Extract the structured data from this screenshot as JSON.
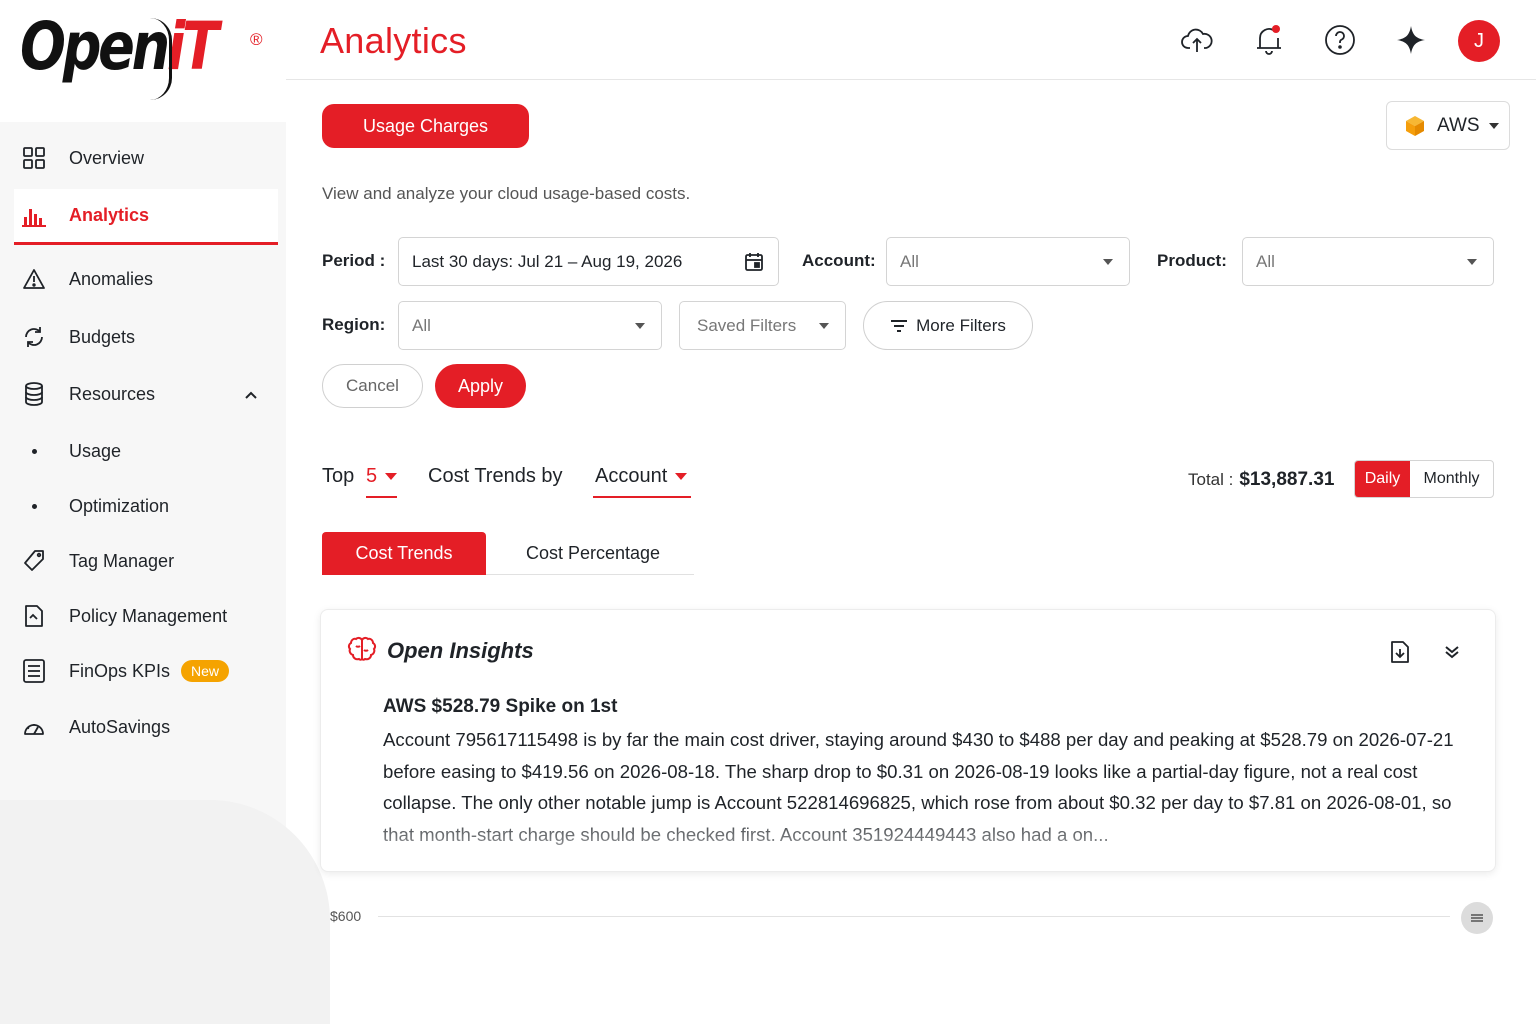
{
  "brand": {
    "name_left": "Open",
    "name_right": "iT",
    "registered": "®"
  },
  "sidebar": {
    "items": [
      {
        "label": "Overview",
        "icon": "grid-icon"
      },
      {
        "label": "Analytics",
        "icon": "bar-chart-icon",
        "active": true
      },
      {
        "label": "Anomalies",
        "icon": "warning-icon"
      },
      {
        "label": "Budgets",
        "icon": "refresh-icon"
      },
      {
        "label": "Resources",
        "icon": "database-icon",
        "expanded": true
      },
      {
        "label": "Usage",
        "icon": "bullet"
      },
      {
        "label": "Optimization",
        "icon": "bullet"
      },
      {
        "label": "Tag Manager",
        "icon": "tag-icon"
      },
      {
        "label": "Policy Management",
        "icon": "policy-icon"
      },
      {
        "label": "FinOps KPIs",
        "icon": "list-icon",
        "badge": "New"
      },
      {
        "label": "AutoSavings",
        "icon": "gauge-icon"
      }
    ]
  },
  "header": {
    "title": "Analytics",
    "avatar_initial": "J",
    "icons": [
      "cloud-upload-icon",
      "bell-icon",
      "help-icon",
      "sparkle-icon"
    ]
  },
  "toolbar": {
    "usage_charges": "Usage Charges",
    "cloud_provider": "AWS"
  },
  "subtitle": "View and analyze your cloud usage-based costs.",
  "filters": {
    "period_label": "Period :",
    "period_value": "Last 30 days: Jul 21 – Aug 19, 2026",
    "account_label": "Account:",
    "account_value": "All",
    "product_label": "Product:",
    "product_value": "All",
    "region_label": "Region:",
    "region_value": "All",
    "saved_filters": "Saved Filters",
    "more_filters": "More Filters",
    "cancel": "Cancel",
    "apply": "Apply"
  },
  "trends": {
    "top_label": "Top",
    "top_value": "5",
    "by_label": "Cost Trends by",
    "by_value": "Account",
    "total_label": "Total :",
    "total_value": "$13,887.31",
    "daily": "Daily",
    "monthly": "Monthly",
    "active_granularity": "Daily"
  },
  "tabs": {
    "cost_trends": "Cost Trends",
    "cost_percentage": "Cost Percentage",
    "active": "Cost Trends"
  },
  "insights": {
    "title": "Open Insights",
    "headline": "AWS $528.79 Spike on 1st",
    "body": "Account 795617115498 is by far the main cost driver, staying around $430 to $488 per day and peaking at $528.79 on 2026-07-21 before easing to $419.56 on 2026-08-18. The sharp drop to $0.31 on 2026-08-19 looks like a partial-day figure, not a real cost collapse. The only other notable jump is Account 522814696825, which rose from about $0.32 per day to $7.81 on 2026-08-01, so that month-start charge should be checked first. Account 351924449443 also had a on..."
  },
  "chart": {
    "y_tick_top": "$600"
  },
  "colors": {
    "accent": "#e41e26",
    "badge": "#f5a300"
  }
}
